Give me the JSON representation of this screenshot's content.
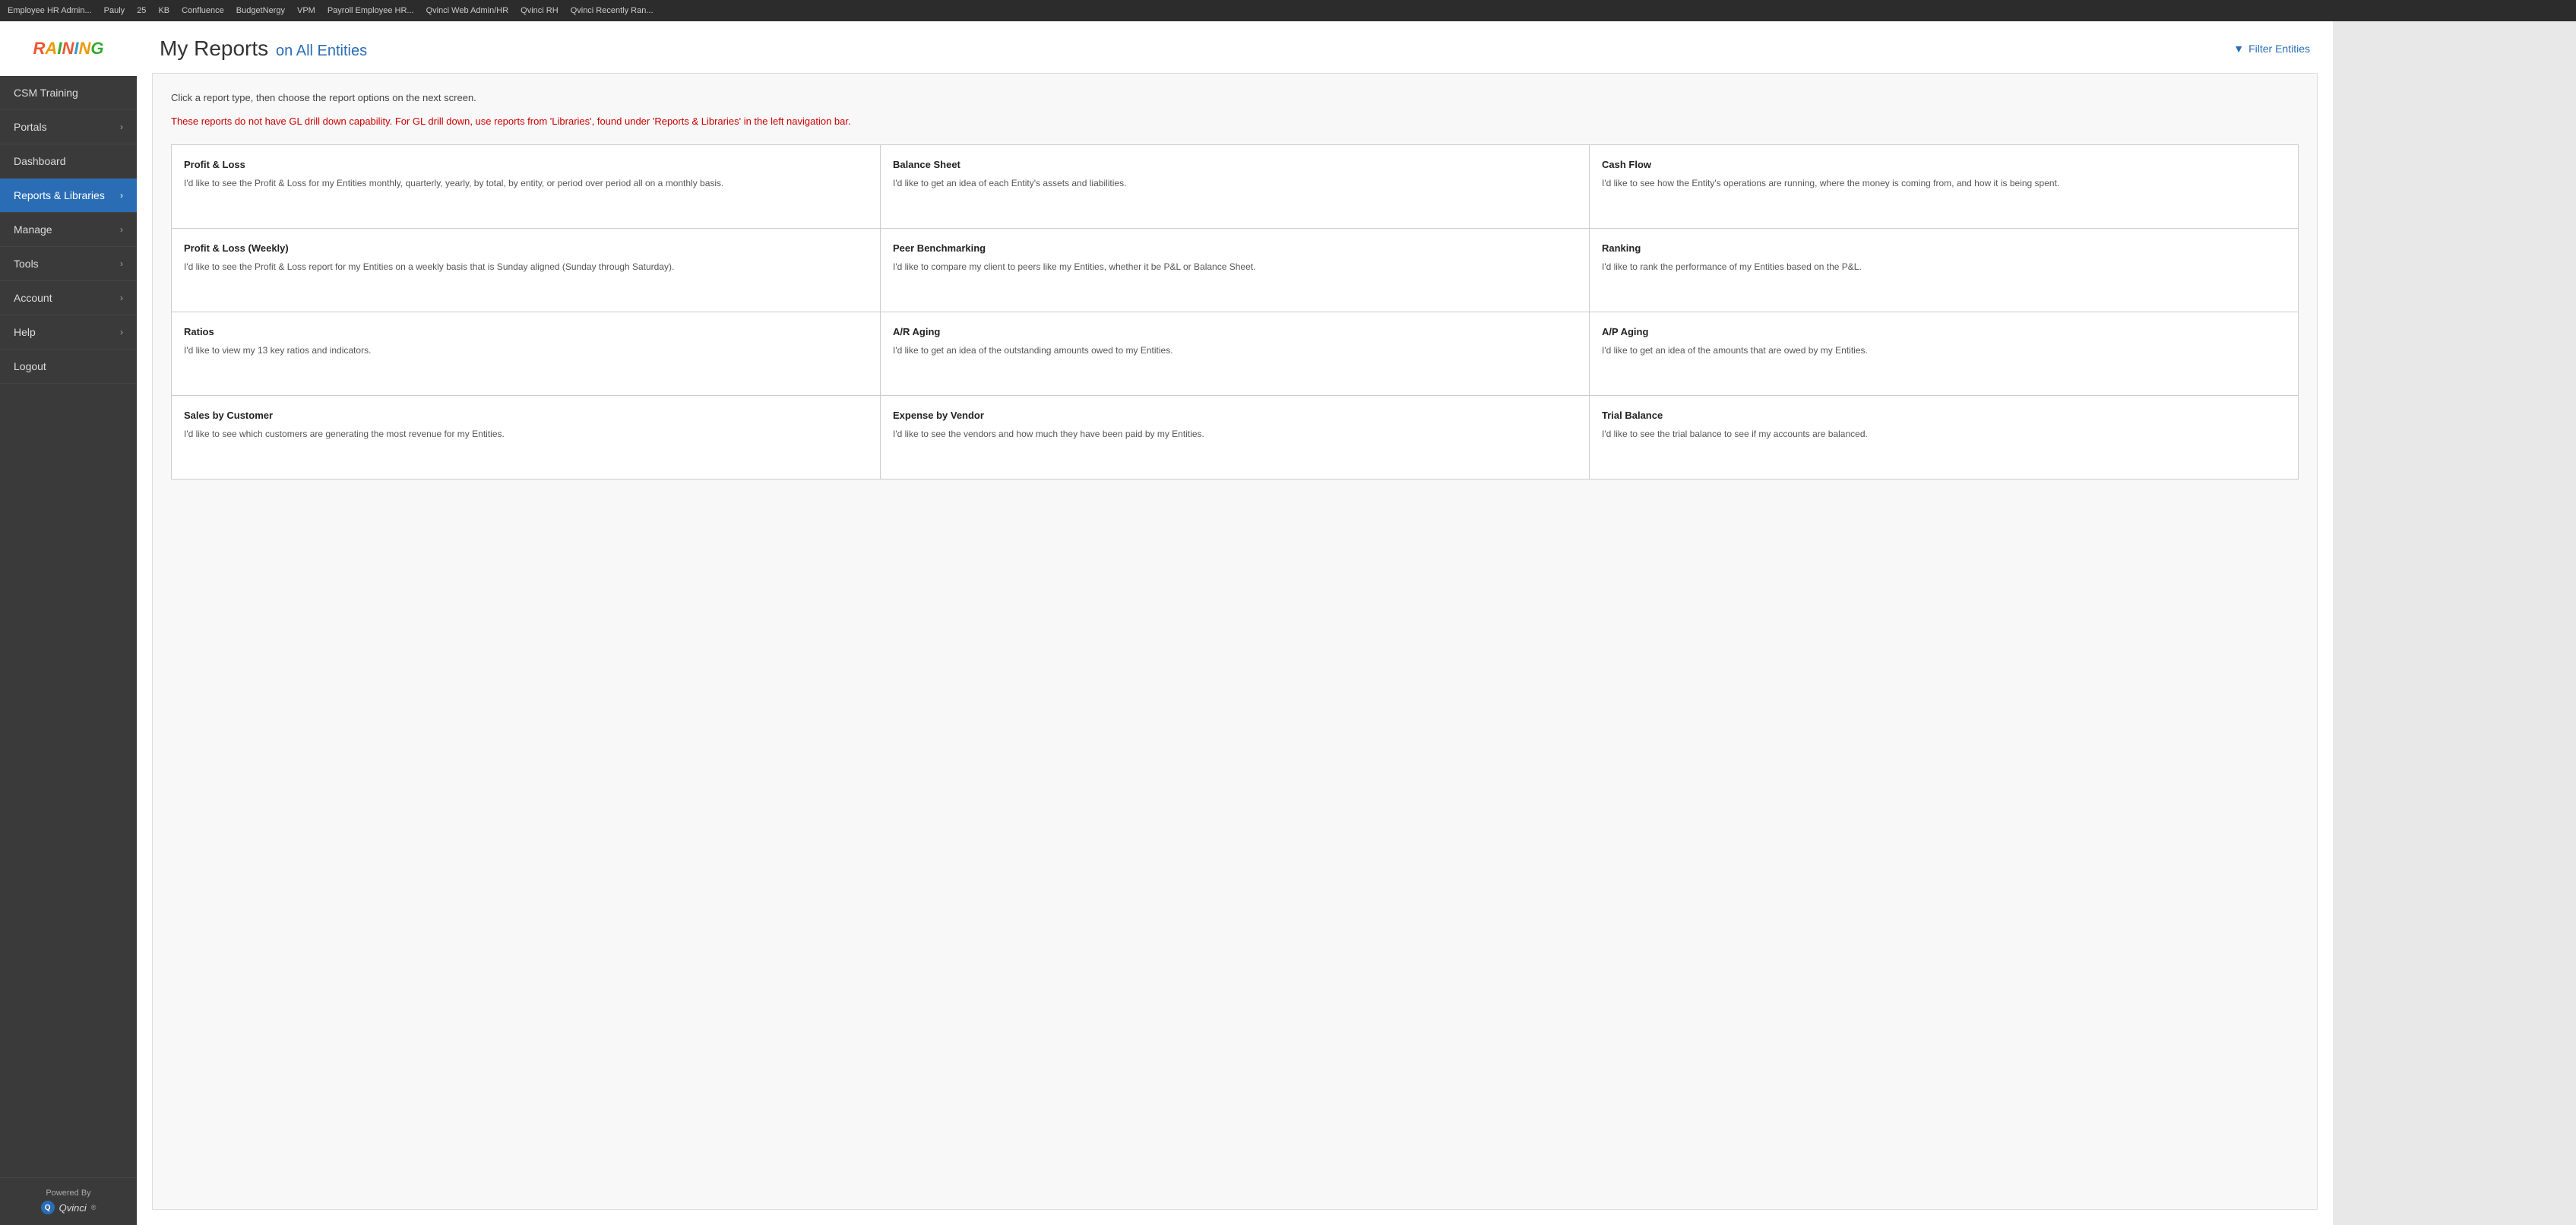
{
  "topNav": {
    "items": [
      "Employee HR Admin...",
      "Pauly",
      "25",
      "KB",
      "Confluence",
      "BudgetNergy",
      "VPM",
      "Payroll Employee HR...",
      "Qvinci Web Admin/HR",
      "Qvinci RH",
      "Qvinci Recently Ran..."
    ]
  },
  "sidebar": {
    "logo": {
      "text": "RAINING",
      "subtitle": "Powered By"
    },
    "items": [
      {
        "label": "CSM Training",
        "hasChevron": false,
        "active": false
      },
      {
        "label": "Portals",
        "hasChevron": true,
        "active": false
      },
      {
        "label": "Dashboard",
        "hasChevron": false,
        "active": false
      },
      {
        "label": "Reports & Libraries",
        "hasChevron": true,
        "active": true
      },
      {
        "label": "Manage",
        "hasChevron": true,
        "active": false
      },
      {
        "label": "Tools",
        "hasChevron": true,
        "active": false
      },
      {
        "label": "Account",
        "hasChevron": true,
        "active": false
      },
      {
        "label": "Help",
        "hasChevron": true,
        "active": false
      },
      {
        "label": "Logout",
        "hasChevron": false,
        "active": false
      }
    ],
    "poweredBy": "Powered By",
    "brandName": "Qvinci"
  },
  "header": {
    "title": "My Reports",
    "subtitle": "on All Entities",
    "filterLabel": "Filter Entities"
  },
  "reports": {
    "instruction": "Click a report type, then choose the report options on the next screen.",
    "warning": "These reports do not have GL drill down capability. For GL drill down, use reports from 'Libraries', found under 'Reports & Libraries' in the left navigation bar.",
    "cells": [
      {
        "title": "Profit & Loss",
        "desc": "I'd like to see the Profit & Loss for my Entities monthly, quarterly, yearly, by total, by entity, or period over period all on a monthly basis."
      },
      {
        "title": "Balance Sheet",
        "desc": "I'd like to get an idea of each Entity's assets and liabilities."
      },
      {
        "title": "Cash Flow",
        "desc": "I'd like to see how the Entity's operations are running, where the money is coming from, and how it is being spent."
      },
      {
        "title": "Profit & Loss (Weekly)",
        "desc": "I'd like to see the Profit & Loss report for my Entities on a weekly basis that is Sunday aligned (Sunday through Saturday)."
      },
      {
        "title": "Peer Benchmarking",
        "desc": "I'd like to compare my client to peers like my Entities, whether it be P&L or Balance Sheet."
      },
      {
        "title": "Ranking",
        "desc": "I'd like to rank the performance of my Entities based on the P&L."
      },
      {
        "title": "Ratios",
        "desc": "I'd like to view my 13 key ratios and indicators."
      },
      {
        "title": "A/R Aging",
        "desc": "I'd like to get an idea of the outstanding amounts owed to my Entities."
      },
      {
        "title": "A/P Aging",
        "desc": "I'd like to get an idea of the amounts that are owed by my Entities."
      },
      {
        "title": "Sales by Customer",
        "desc": "I'd like to see which customers are generating the most revenue for my Entities."
      },
      {
        "title": "Expense by Vendor",
        "desc": "I'd like to see the vendors and how much they have been paid by my Entities."
      },
      {
        "title": "Trial Balance",
        "desc": "I'd like to see the trial balance to see if my accounts are balanced."
      }
    ]
  }
}
